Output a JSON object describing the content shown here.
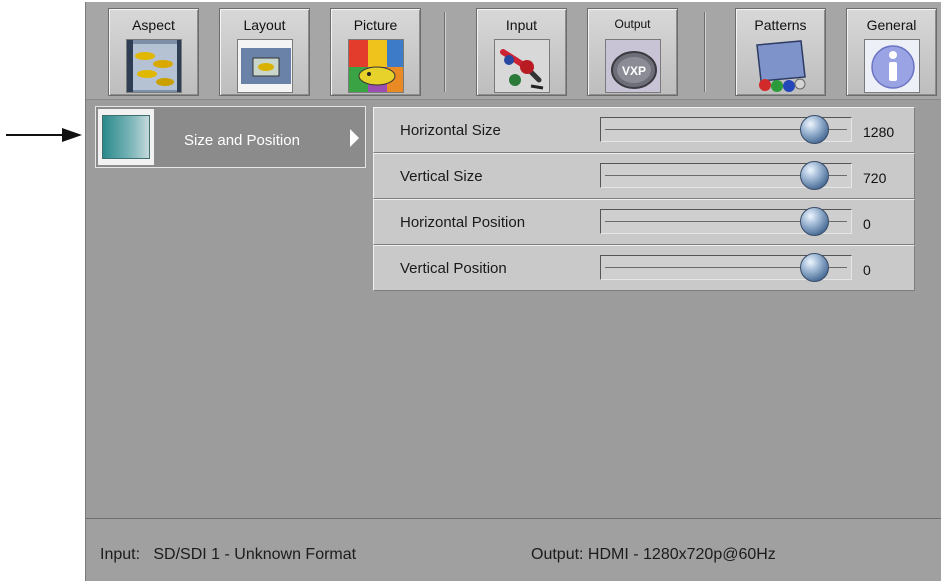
{
  "toolbar": {
    "buttons": [
      {
        "label": "Aspect"
      },
      {
        "label": "Layout"
      },
      {
        "label": "Picture"
      },
      {
        "label": "Input"
      },
      {
        "label": "Output",
        "icon_text": "VXP"
      },
      {
        "label": "Patterns"
      },
      {
        "label": "General"
      }
    ]
  },
  "menu": {
    "selected_item": "Size and Position"
  },
  "settings": [
    {
      "label": "Horizontal Size",
      "value": "1280",
      "level": 0.9
    },
    {
      "label": "Vertical Size",
      "value": "720",
      "level": 0.9
    },
    {
      "label": "Horizontal Position",
      "value": "0",
      "level": 0.9
    },
    {
      "label": "Vertical Position",
      "value": "0",
      "level": 0.9
    }
  ],
  "status": {
    "input": "Input:   SD/SDI 1 - Unknown Format",
    "output": "Output: HDMI - 1280x720p@60Hz"
  }
}
